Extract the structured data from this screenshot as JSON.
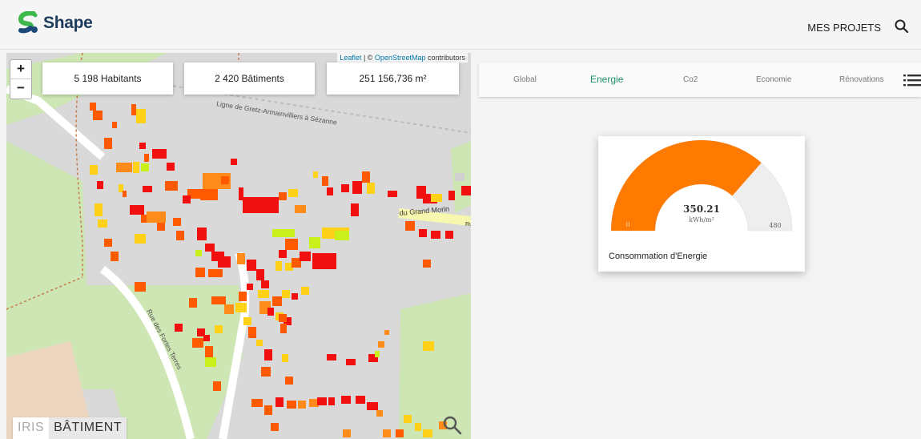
{
  "header": {
    "brand": "Shape",
    "nav_projects": "MES PROJETS",
    "brand_colors": {
      "primary": "#1b3a5c",
      "accent": "#3db84a",
      "dark": "#1b4a7a"
    }
  },
  "map": {
    "attribution_leaflet": "Leaflet",
    "attribution_sep": " | © ",
    "attribution_osm": "OpenStreetMap",
    "attribution_tail": " contributors",
    "zoom_in": "+",
    "zoom_out": "−",
    "stats": {
      "habitants": "5 198 Habitants",
      "batiments": "2 420 Bâtiments",
      "surface": "251 156,736 m²"
    },
    "street_labels": {
      "rail": "Ligne de Gretz-Armainvilliers à Sézanne",
      "grand_morin": "du Grand Morin",
      "fortes_terres": "Rue des Fortes Terres",
      "ru": "Ru"
    },
    "toggle": {
      "iris": "IRIS",
      "batiment": "BÂTIMENT",
      "selected": "BÂTIMENT"
    },
    "building_colors": [
      "#f01010",
      "#ff5a00",
      "#ff8c1a",
      "#ffd21a",
      "#c9f01a",
      "#8ee81a",
      "#d0d0d0"
    ]
  },
  "tabs": [
    {
      "label": "Global"
    },
    {
      "label": "Energie"
    },
    {
      "label": "Co2"
    },
    {
      "label": "Economie"
    },
    {
      "label": "Rénovations"
    }
  ],
  "active_tab": "Energie",
  "gauge": {
    "value_text": "350.21",
    "value": 350.21,
    "unit": "kWh/m²",
    "min": "0",
    "max": "480",
    "min_value": 0,
    "max_value": 480,
    "fill_color": "#ff7a00",
    "track_color": "#eeeeee",
    "label": "Consommation d'Energie"
  }
}
